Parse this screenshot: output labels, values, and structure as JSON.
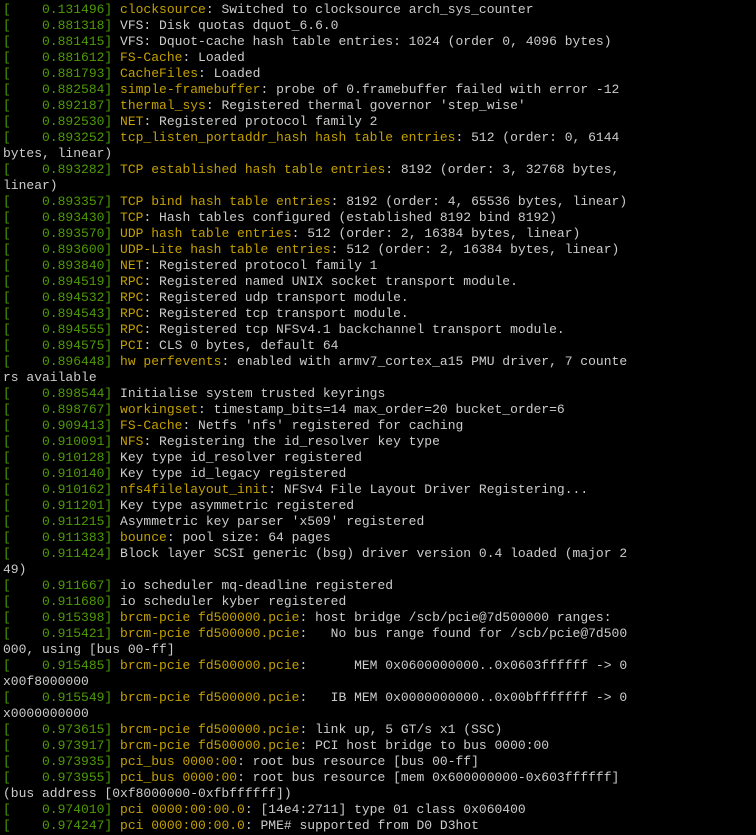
{
  "colors": {
    "background": "#000000",
    "text": "#cccccc",
    "timestamp": "#4e9a06",
    "subsystem": "#c4a000"
  },
  "lines": [
    {
      "ts": "[    0.131496] ",
      "sub": "clocksource",
      "msg": ": Switched to clocksource arch_sys_counter"
    },
    {
      "ts": "[    0.881318] ",
      "sub": "",
      "msg": "VFS: Disk quotas dquot_6.6.0"
    },
    {
      "ts": "[    0.881415] ",
      "sub": "",
      "msg": "VFS: Dquot-cache hash table entries: 1024 (order 0, 4096 bytes)"
    },
    {
      "ts": "[    0.881612] ",
      "sub": "FS-Cache",
      "msg": ": Loaded"
    },
    {
      "ts": "[    0.881793] ",
      "sub": "CacheFiles",
      "msg": ": Loaded"
    },
    {
      "ts": "[    0.882584] ",
      "sub": "simple-framebuffer",
      "msg": ": probe of 0.framebuffer failed with error -12"
    },
    {
      "ts": "[    0.892187] ",
      "sub": "thermal_sys",
      "msg": ": Registered thermal governor 'step_wise'"
    },
    {
      "ts": "[    0.892530] ",
      "sub": "NET",
      "msg": ": Registered protocol family 2"
    },
    {
      "ts": "[    0.893252] ",
      "sub": "tcp_listen_portaddr_hash hash table entries",
      "msg": ": 512 (order: 0, 6144"
    },
    {
      "ts": "",
      "sub": "",
      "msg": "bytes, linear)"
    },
    {
      "ts": "[    0.893282] ",
      "sub": "TCP established hash table entries",
      "msg": ": 8192 (order: 3, 32768 bytes,"
    },
    {
      "ts": "",
      "sub": "",
      "msg": "linear)"
    },
    {
      "ts": "[    0.893357] ",
      "sub": "TCP bind hash table entries",
      "msg": ": 8192 (order: 4, 65536 bytes, linear)"
    },
    {
      "ts": "[    0.893430] ",
      "sub": "TCP",
      "msg": ": Hash tables configured (established 8192 bind 8192)"
    },
    {
      "ts": "[    0.893570] ",
      "sub": "UDP hash table entries",
      "msg": ": 512 (order: 2, 16384 bytes, linear)"
    },
    {
      "ts": "[    0.893600] ",
      "sub": "UDP-Lite hash table entries",
      "msg": ": 512 (order: 2, 16384 bytes, linear)"
    },
    {
      "ts": "[    0.893840] ",
      "sub": "NET",
      "msg": ": Registered protocol family 1"
    },
    {
      "ts": "[    0.894519] ",
      "sub": "RPC",
      "msg": ": Registered named UNIX socket transport module."
    },
    {
      "ts": "[    0.894532] ",
      "sub": "RPC",
      "msg": ": Registered udp transport module."
    },
    {
      "ts": "[    0.894543] ",
      "sub": "RPC",
      "msg": ": Registered tcp transport module."
    },
    {
      "ts": "[    0.894555] ",
      "sub": "RPC",
      "msg": ": Registered tcp NFSv4.1 backchannel transport module."
    },
    {
      "ts": "[    0.894575] ",
      "sub": "PCI",
      "msg": ": CLS 0 bytes, default 64"
    },
    {
      "ts": "[    0.896448] ",
      "sub": "hw perfevents",
      "msg": ": enabled with armv7_cortex_a15 PMU driver, 7 counte"
    },
    {
      "ts": "",
      "sub": "",
      "msg": "rs available"
    },
    {
      "ts": "[    0.898544] ",
      "sub": "",
      "msg": "Initialise system trusted keyrings"
    },
    {
      "ts": "[    0.898767] ",
      "sub": "workingset",
      "msg": ": timestamp_bits=14 max_order=20 bucket_order=6"
    },
    {
      "ts": "[    0.909413] ",
      "sub": "FS-Cache",
      "msg": ": Netfs 'nfs' registered for caching"
    },
    {
      "ts": "[    0.910091] ",
      "sub": "NFS",
      "msg": ": Registering the id_resolver key type"
    },
    {
      "ts": "[    0.910128] ",
      "sub": "",
      "msg": "Key type id_resolver registered"
    },
    {
      "ts": "[    0.910140] ",
      "sub": "",
      "msg": "Key type id_legacy registered"
    },
    {
      "ts": "[    0.910162] ",
      "sub": "nfs4filelayout_init",
      "msg": ": NFSv4 File Layout Driver Registering..."
    },
    {
      "ts": "[    0.911201] ",
      "sub": "",
      "msg": "Key type asymmetric registered"
    },
    {
      "ts": "[    0.911215] ",
      "sub": "",
      "msg": "Asymmetric key parser 'x509' registered"
    },
    {
      "ts": "[    0.911383] ",
      "sub": "bounce",
      "msg": ": pool size: 64 pages"
    },
    {
      "ts": "[    0.911424] ",
      "sub": "",
      "msg": "Block layer SCSI generic (bsg) driver version 0.4 loaded (major 2"
    },
    {
      "ts": "",
      "sub": "",
      "msg": "49)"
    },
    {
      "ts": "[    0.911667] ",
      "sub": "",
      "msg": "io scheduler mq-deadline registered"
    },
    {
      "ts": "[    0.911680] ",
      "sub": "",
      "msg": "io scheduler kyber registered"
    },
    {
      "ts": "[    0.915398] ",
      "sub": "brcm-pcie fd500000.pcie",
      "msg": ": host bridge /scb/pcie@7d500000 ranges:"
    },
    {
      "ts": "[    0.915421] ",
      "sub": "brcm-pcie fd500000.pcie",
      "msg": ":   No bus range found for /scb/pcie@7d500"
    },
    {
      "ts": "",
      "sub": "",
      "msg": "000, using [bus 00-ff]"
    },
    {
      "ts": "[    0.915485] ",
      "sub": "brcm-pcie fd500000.pcie",
      "msg": ":      MEM 0x0600000000..0x0603ffffff -> 0"
    },
    {
      "ts": "",
      "sub": "",
      "msg": "x00f8000000"
    },
    {
      "ts": "[    0.915549] ",
      "sub": "brcm-pcie fd500000.pcie",
      "msg": ":   IB MEM 0x0000000000..0x00bfffffff -> 0"
    },
    {
      "ts": "",
      "sub": "",
      "msg": "x0000000000"
    },
    {
      "ts": "[    0.973615] ",
      "sub": "brcm-pcie fd500000.pcie",
      "msg": ": link up, 5 GT/s x1 (SSC)"
    },
    {
      "ts": "[    0.973917] ",
      "sub": "brcm-pcie fd500000.pcie",
      "msg": ": PCI host bridge to bus 0000:00"
    },
    {
      "ts": "[    0.973935] ",
      "sub": "pci_bus 0000:00",
      "msg": ": root bus resource [bus 00-ff]"
    },
    {
      "ts": "[    0.973955] ",
      "sub": "pci_bus 0000:00",
      "msg": ": root bus resource [mem 0x600000000-0x603ffffff]"
    },
    {
      "ts": "",
      "sub": "",
      "msg": "(bus address [0xf8000000-0xfbffffff])"
    },
    {
      "ts": "[    0.974010] ",
      "sub": "pci 0000:00:00.0",
      "msg": ": [14e4:2711] type 01 class 0x060400"
    },
    {
      "ts": "[    0.974247] ",
      "sub": "pci 0000:00:00.0",
      "msg": ": PME# supported from D0 D3hot"
    }
  ]
}
